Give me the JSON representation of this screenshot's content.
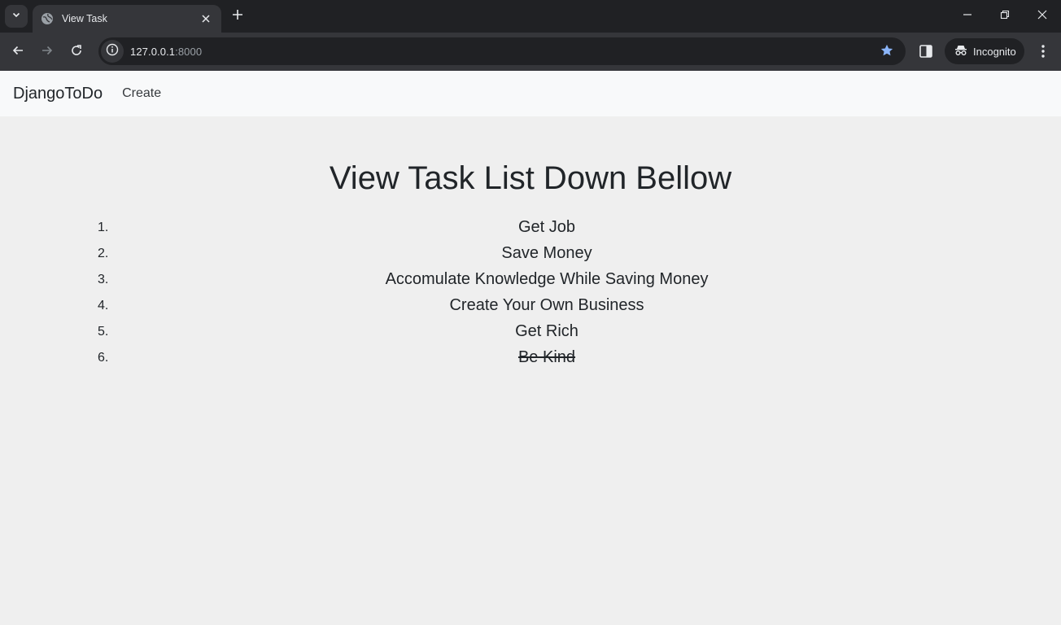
{
  "browser": {
    "tab_title": "View Task",
    "url_host": "127.0.0.1",
    "url_port": ":8000",
    "incognito_label": "Incognito"
  },
  "navbar": {
    "brand": "DjangoToDo",
    "create_link": "Create"
  },
  "main": {
    "heading": "View Task List Down Bellow",
    "tasks": [
      {
        "number": "1.",
        "text": "Get Job",
        "completed": false
      },
      {
        "number": "2.",
        "text": "Save Money",
        "completed": false
      },
      {
        "number": "3.",
        "text": "Accomulate Knowledge While Saving Money",
        "completed": false
      },
      {
        "number": "4.",
        "text": "Create Your Own Business",
        "completed": false
      },
      {
        "number": "5.",
        "text": "Get Rich",
        "completed": false
      },
      {
        "number": "6.",
        "text": "Be Kind",
        "completed": true
      }
    ]
  },
  "icons": [
    "tab-search-icon",
    "globe-icon",
    "close-icon",
    "plus-icon",
    "minimize-icon",
    "restore-icon",
    "window-close-icon",
    "back-arrow-icon",
    "forward-arrow-icon",
    "reload-icon",
    "info-icon",
    "star-icon",
    "side-panel-icon",
    "incognito-icon",
    "more-vert-icon"
  ],
  "colors": {
    "star": "#8ab4f8",
    "chrome_dark": "#202124",
    "chrome_mid": "#35363a",
    "page_bg": "#efefef"
  }
}
